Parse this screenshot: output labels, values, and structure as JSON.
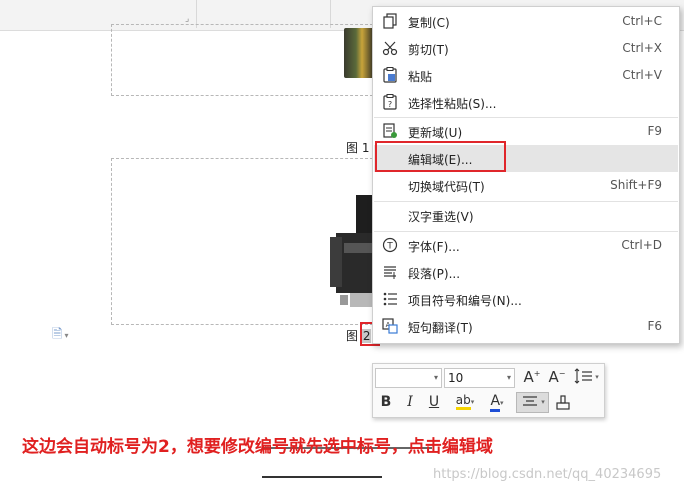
{
  "document": {
    "figure1_caption_prefix": "图 1",
    "figure2_caption_prefix": "图 ",
    "figure2_number": "2"
  },
  "context_menu": {
    "items": [
      {
        "label": "复制(C)",
        "shortcut": "Ctrl+C",
        "icon": "copy-icon"
      },
      {
        "label": "剪切(T)",
        "shortcut": "Ctrl+X",
        "icon": "scissors-icon"
      },
      {
        "label": "粘贴",
        "shortcut": "Ctrl+V",
        "icon": "paste-icon"
      },
      {
        "label": "选择性粘贴(S)...",
        "shortcut": "",
        "icon": "paste-special-icon"
      },
      {
        "label": "更新域(U)",
        "shortcut": "F9",
        "icon": "update-field-icon"
      },
      {
        "label": "编辑域(E)...",
        "shortcut": "",
        "icon": ""
      },
      {
        "label": "切换域代码(T)",
        "shortcut": "Shift+F9",
        "icon": ""
      },
      {
        "label": "汉字重选(V)",
        "shortcut": "",
        "icon": ""
      },
      {
        "label": "字体(F)...",
        "shortcut": "Ctrl+D",
        "icon": "font-icon"
      },
      {
        "label": "段落(P)...",
        "shortcut": "",
        "icon": "paragraph-icon"
      },
      {
        "label": "项目符号和编号(N)...",
        "shortcut": "",
        "icon": "bullets-icon"
      },
      {
        "label": "短句翻译(T)",
        "shortcut": "F6",
        "icon": "translate-icon"
      }
    ]
  },
  "mini_toolbar": {
    "font_name": "",
    "font_size": "10",
    "bold": "B",
    "italic": "I",
    "underline": "U",
    "highlight": "ab",
    "font_color": "A",
    "grow_font": "A",
    "shrink_font": "A"
  },
  "annotation": {
    "note": "这边会自动标号为2，想要修改编号就先选中标号，点击编辑域",
    "watermark": "https://blog.csdn.net/qq_40234695"
  },
  "colors": {
    "annotation_red": "#e0262b",
    "highlight_yellow": "#f5d300",
    "font_color_blue": "#1f4fd6"
  }
}
